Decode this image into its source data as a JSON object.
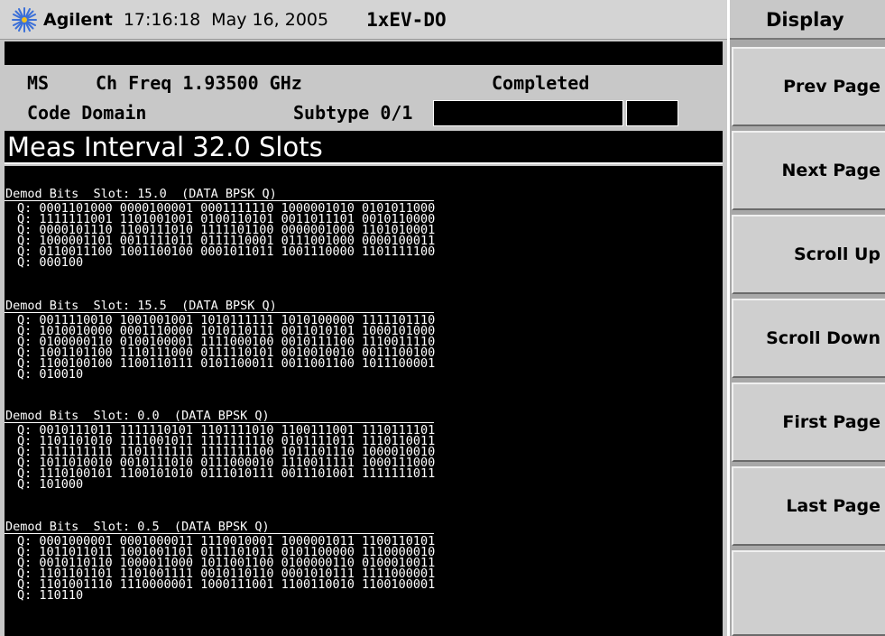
{
  "header": {
    "brand": "Agilent",
    "time": "17:16:18",
    "date": "May 16, 2005",
    "mode": "1xEV-DO"
  },
  "info": {
    "ms_label": "MS",
    "ch_freq": "Ch Freq 1.93500 GHz",
    "status": "Completed",
    "measurement": "Code Domain",
    "subtype": "Subtype 0/1"
  },
  "interval": "Meas Interval 32.0 Slots",
  "blocks": [
    {
      "header": "Demod Bits  Slot: 15.0  (DATA BPSK Q)",
      "rows": [
        "Q: 0001101000 0000100001 0001111110 1000001010 0101011000",
        "Q: 1111111001 1101001001 0100110101 0011011101 0010110000",
        "Q: 0000101110 1100111010 1111101100 0000001000 1101010001",
        "Q: 1000001101 0011111011 0111110001 0111001000 0000100011",
        "Q: 0110011100 1001100100 0001011011 1001110000 1101111100",
        "Q: 000100"
      ]
    },
    {
      "header": "Demod Bits  Slot: 15.5  (DATA BPSK Q)",
      "rows": [
        "Q: 0011110010 1001001001 1010111111 1010100000 1111101110",
        "Q: 1010010000 0001110000 1010110111 0011010101 1000101000",
        "Q: 0100000110 0100100001 1111000100 0010111100 1110011110",
        "Q: 1001101100 1110111000 0111110101 0010010010 0011100100",
        "Q: 1100100100 1100110111 0101100011 0011001100 1011100001",
        "Q: 010010"
      ]
    },
    {
      "header": "Demod Bits  Slot: 0.0  (DATA BPSK Q)",
      "rows": [
        "Q: 0010111011 1111110101 1101111010 1100111001 1110111101",
        "Q: 1101101010 1111001011 1111111110 0101111011 1110110011",
        "Q: 1111111111 1101111111 1111111100 1011101110 1000010010",
        "Q: 1011010010 0010111010 0111000010 1110011111 1000111000",
        "Q: 1110100101 1100101010 0111010111 0011101001 1111111011",
        "Q: 101000"
      ]
    },
    {
      "header": "Demod Bits  Slot: 0.5  (DATA BPSK Q)",
      "rows": [
        "Q: 0001000001 0001000011 1110010001 1000001011 1100110101",
        "Q: 1011011011 1001001101 0111101011 0101100000 1110000010",
        "Q: 0010110110 1000011000 1011001100 0100000110 0100010011",
        "Q: 1101101101 1101001111 0010110110 0001010111 1111000001",
        "Q: 1101001110 1110000001 1000111001 1100110010 1100100001",
        "Q: 110110"
      ]
    }
  ],
  "menu": {
    "title": "Display",
    "keys": [
      "Prev Page",
      "Next Page",
      "Scroll Up",
      "Scroll Down",
      "First Page",
      "Last Page",
      ""
    ]
  }
}
